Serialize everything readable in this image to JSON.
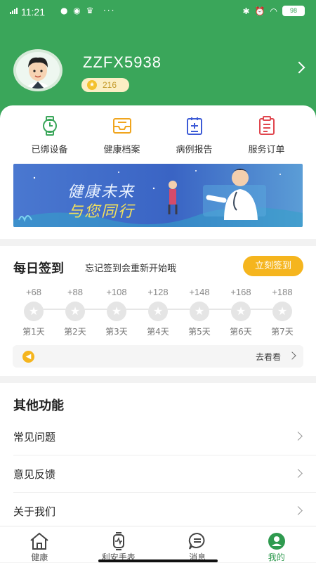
{
  "status_bar": {
    "time": "11:21",
    "battery": "98"
  },
  "profile": {
    "username": "ZZFX5938",
    "coins": "216"
  },
  "quick_actions": [
    {
      "label": "已绑设备",
      "icon": "watch-icon"
    },
    {
      "label": "健康档案",
      "icon": "inbox-icon"
    },
    {
      "label": "病例报告",
      "icon": "clipboard-icon"
    },
    {
      "label": "服务订单",
      "icon": "order-icon"
    }
  ],
  "banner": {
    "line1": "健康未来",
    "line2": "与您同行"
  },
  "checkin": {
    "title": "每日签到",
    "subtitle": "忘记签到会重新开始哦",
    "button": "立刻签到",
    "days": [
      {
        "points": "+68",
        "label": "第1天"
      },
      {
        "points": "+88",
        "label": "第2天"
      },
      {
        "points": "+108",
        "label": "第3天"
      },
      {
        "points": "+128",
        "label": "第4天"
      },
      {
        "points": "+148",
        "label": "第5天"
      },
      {
        "points": "+168",
        "label": "第6天"
      },
      {
        "points": "+188",
        "label": "第7天"
      }
    ],
    "notice_link": "去看看"
  },
  "other": {
    "title": "其他功能",
    "items": [
      "常见问题",
      "意见反馈",
      "关于我们"
    ]
  },
  "tabs": [
    {
      "label": "健康",
      "icon": "home-icon"
    },
    {
      "label": "利安手表",
      "icon": "smartwatch-icon"
    },
    {
      "label": "消息",
      "icon": "message-icon"
    },
    {
      "label": "我的",
      "icon": "user-icon"
    }
  ],
  "colors": {
    "primary": "#3aa65a",
    "accent": "#f5b51e"
  }
}
